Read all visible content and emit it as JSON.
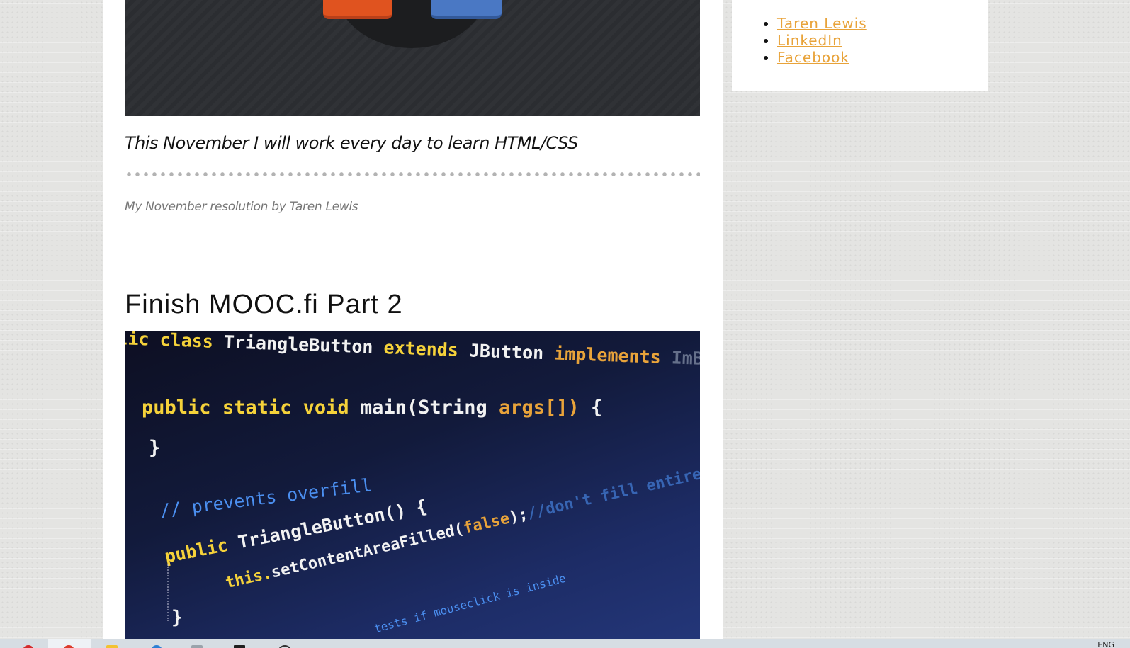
{
  "post": {
    "caption": "This November I will work every day to learn HTML/CSS",
    "byline": "My November resolution by Taren Lewis",
    "next_title": "Finish MOOC.fi Part 2"
  },
  "code_image": {
    "lines": [
      {
        "parts": [
          "lic class",
          "TriangleButton",
          "extends",
          "JButton",
          "implements",
          "ImBiF {"
        ]
      },
      {
        "parts": [
          "public",
          "static void",
          "main(String",
          "args[])",
          "{"
        ]
      },
      {
        "parts": [
          "}"
        ]
      },
      {
        "parts": [
          "// prevents overfill"
        ]
      },
      {
        "parts": [
          "public",
          "TriangleButton() {"
        ]
      },
      {
        "parts": [
          "this.",
          "setContentAreaFilled(",
          "false",
          ");",
          "//don't fill entire rect"
        ]
      },
      {
        "parts": [
          "}"
        ]
      },
      {
        "parts": [
          "tests if mouseclick is inside"
        ]
      }
    ]
  },
  "sidebar": {
    "links": [
      {
        "label": "Taren Lewis"
      },
      {
        "label": "LinkedIn"
      },
      {
        "label": "Facebook"
      }
    ]
  },
  "taskbar": {
    "language": "ENG",
    "icons": [
      "opera-icon",
      "chrome-icon",
      "folder-icon",
      "edge-icon",
      "mail-icon",
      "terminal-icon",
      "search-icon"
    ]
  },
  "colors": {
    "link": "#e8a33a",
    "page_background": "#e4e4e2",
    "panel": "#ffffff"
  }
}
